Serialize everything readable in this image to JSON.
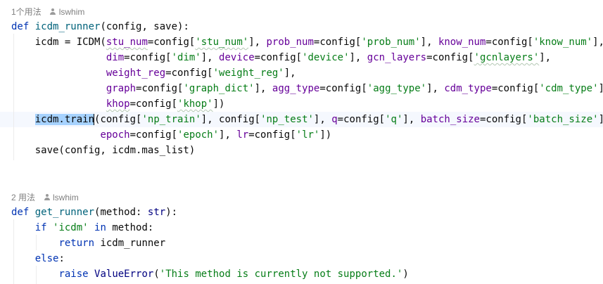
{
  "usage_hints": [
    {
      "count": "1个用法",
      "author": "lswhim"
    },
    {
      "count": "2 用法",
      "author": "lswhim"
    }
  ],
  "code": {
    "def_kw": "def",
    "fn1_name": "icdm_runner",
    "fn1_sig": "(config, save):",
    "l2_a": "icdm = ICDM(",
    "p_stu": "stu_num",
    "s_stu": "'stu_num'",
    "p_prob": "prob_num",
    "s_prob": "'prob_num'",
    "p_know": "know_num",
    "s_know": "'know_num'",
    "p_dim": "dim",
    "s_dim": "'dim'",
    "p_device": "device",
    "s_device": "'device'",
    "p_gcn": "gcn_layers",
    "s_gcn": "'gcnlayers'",
    "p_weight": "weight_reg",
    "s_weight": "'weight_reg'",
    "p_graph": "graph",
    "s_graph": "'graph_dict'",
    "p_agg": "agg_type",
    "s_agg": "'agg_type'",
    "p_cdm": "cdm_type",
    "s_cdm": "'cdm_type'",
    "p_khop": "khop",
    "s_khop": "'khop'",
    "train_call": "icdm.train",
    "s_nptrain": "'np_train'",
    "s_nptest": "'np_test'",
    "p_q": "q",
    "s_q": "'q'",
    "p_batch": "batch_size",
    "s_batch": "'batch_size'",
    "p_epoch": "epoch",
    "s_epoch": "'epoch'",
    "p_lr": "lr",
    "s_lr": "'lr'",
    "save_line": "save(config, icdm.mas_list)",
    "fn2_name": "get_runner",
    "fn2_sig_a": "(method: ",
    "str_type": "str",
    "fn2_sig_b": "):",
    "if_kw": "if",
    "s_icdm": "'icdm'",
    "in_kw": "in",
    "method_colon": " method:",
    "return_kw": "return",
    "return_val": " icdm_runner",
    "else_kw": "else",
    "raise_kw": "raise",
    "value_error": "ValueError",
    "s_error": "'This method is currently not supported.'"
  }
}
